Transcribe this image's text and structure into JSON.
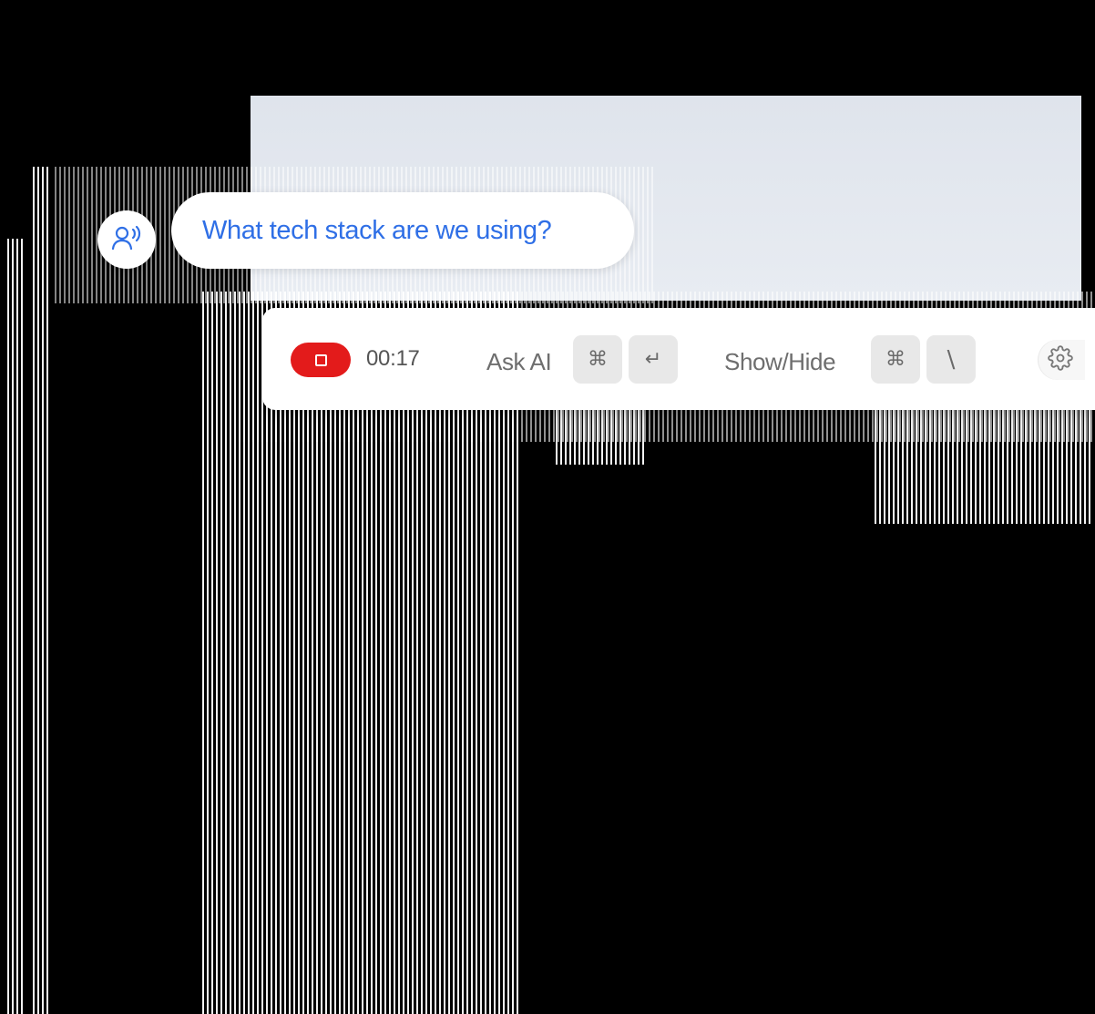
{
  "assistant": {
    "question": "What tech stack are we using?",
    "avatar_icon": "listening-person-icon"
  },
  "toolbar": {
    "stop_icon": "stop-icon",
    "timer": "00:17",
    "ask_ai": {
      "label": "Ask AI",
      "keys": [
        "⌘",
        "↵"
      ]
    },
    "show_hide": {
      "label": "Show/Hide",
      "keys": [
        "⌘",
        "\\"
      ]
    },
    "settings_icon": "gear-icon"
  },
  "colors": {
    "accent": "#2f6fe6",
    "record": "#e31b1b",
    "key_bg": "#e8e8e8"
  }
}
